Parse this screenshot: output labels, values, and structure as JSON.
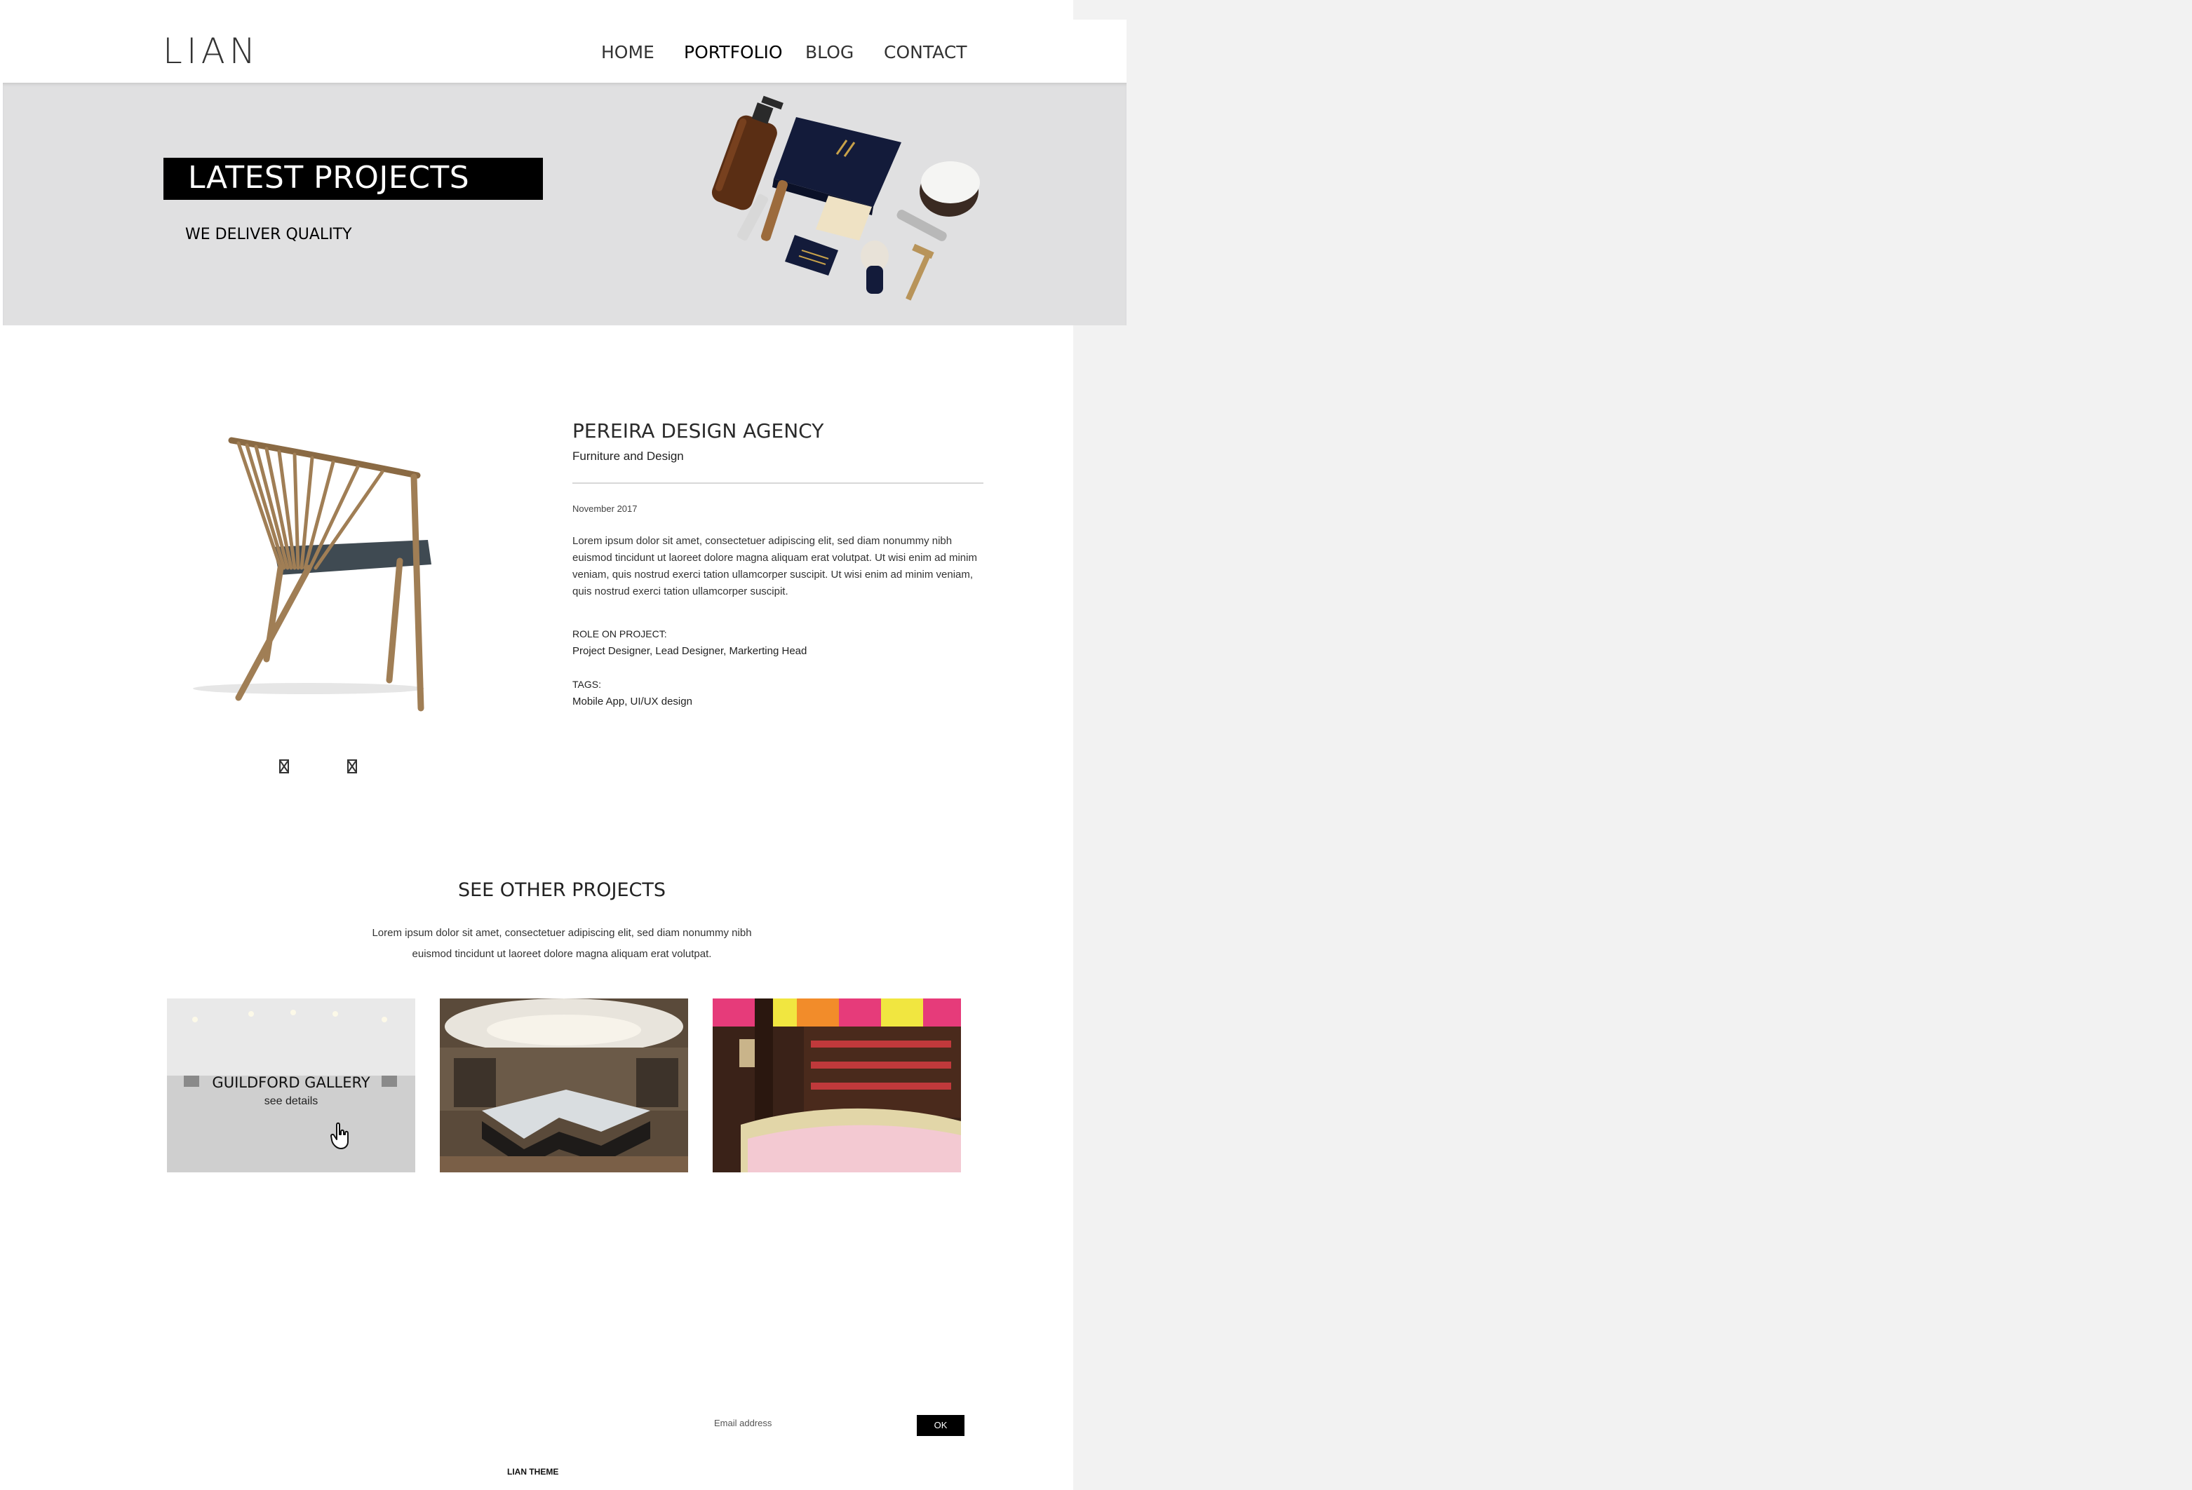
{
  "brand": {
    "logo": "LIAN"
  },
  "nav": {
    "items": [
      "HOME",
      "PORTFOLIO",
      "BLOG",
      "CONTACT"
    ],
    "active": "PORTFOLIO"
  },
  "hero": {
    "title": "LATEST PROJECTS",
    "subtitle": "WE DELIVER QUALITY"
  },
  "project": {
    "title": "PEREIRA DESIGN AGENCY",
    "category": "Furniture and Design",
    "date": "November 2017",
    "description": "Lorem ipsum dolor sit amet, consectetuer adipiscing elit, sed diam nonummy nibh euismod tincidunt ut laoreet dolore magna aliquam erat volutpat. Ut wisi enim ad minim veniam, quis nostrud exerci tation ullamcorper suscipit. Ut wisi enim ad minim veniam, quis nostrud exerci tation ullamcorper suscipit.",
    "role_label": "ROLE ON PROJECT:",
    "role_value": "Project Designer, Lead Designer, Markerting Head",
    "tags_label": "TAGS:",
    "tags_value": "Mobile App, UI/UX design"
  },
  "other": {
    "title": "SEE OTHER PROJECTS",
    "description": "Lorem ipsum dolor sit amet, consectetuer adipiscing elit, sed diam nonummy nibh euismod tincidunt ut laoreet dolore magna aliquam erat volutpat.",
    "items": [
      {
        "title": "GUILDFORD GALLERY",
        "link": "see details"
      }
    ]
  },
  "footer": {
    "email_placeholder": "Email address",
    "ok_label": "OK",
    "brand": "LIAN THEME"
  },
  "colors": {
    "accent": "#000000",
    "hero_bg": "#e0e0e1",
    "page_bg": "#ffffff",
    "side_bg": "#f2f2f2"
  }
}
